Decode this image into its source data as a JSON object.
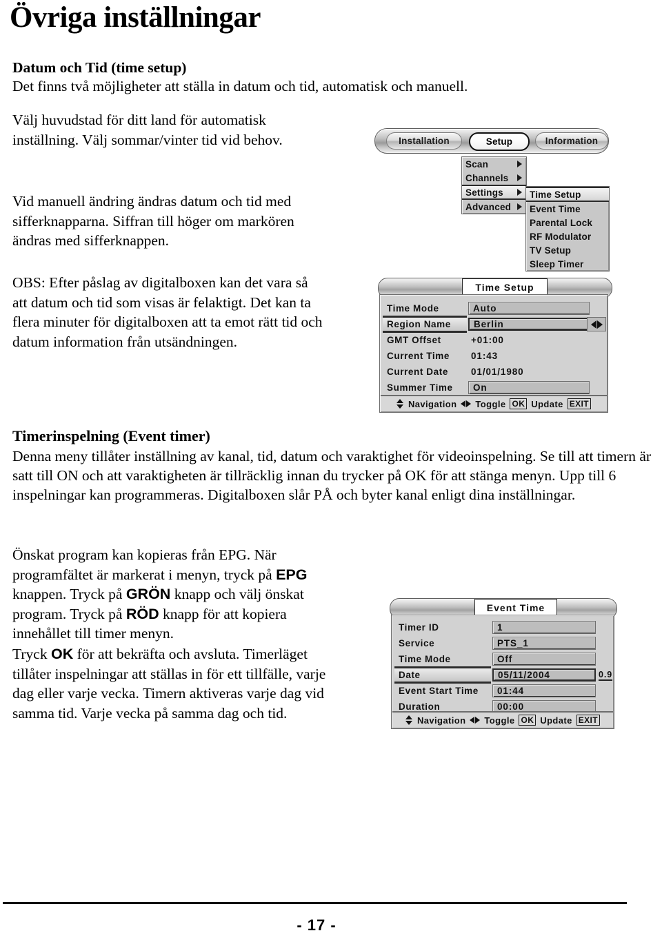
{
  "document": {
    "title": "Övriga inställningar",
    "page_number": "- 17 -"
  },
  "sections": {
    "time_setup": {
      "subheading": "Datum och Tid (time setup)",
      "lead": "Det finns två möjligheter att ställa in datum och tid, automatisk och manuell.",
      "para_auto": "Välj huvudstad för ditt land för automatisk inställning. Välj sommar/vinter tid vid behov.",
      "para_manual": "Vid manuell ändring ändras datum och tid med sifferknapparna. Siffran till höger om markören ändras med sifferknappen.",
      "para_obs": "OBS: Efter påslag av digitalboxen kan det vara så att datum och tid som visas är felaktigt. Det kan ta flera minuter för digitalboxen att ta emot rätt tid och datum information från utsändningen."
    },
    "event_timer": {
      "heading": "Timerinspelning (Event timer)",
      "body": "Denna meny tillåter inställning av kanal, tid, datum och varaktighet för videoinspelning. Se till att timern är satt till ON och att varaktigheten är tillräcklig innan du trycker på OK för att stänga menyn. Upp till 6 inspelningar kan programmeras. Digitalboxen slår PÅ och byter kanal enligt dina inställningar.",
      "epg_para": {
        "p1": "Önskat program kan kopieras från EPG. När programfältet är markerat i menyn, tryck på ",
        "b1": "EPG",
        "p2": " knappen. Tryck på ",
        "b2": "GRÖN",
        "p3": " knapp och välj önskat program. Tryck på ",
        "b3": "RÖD",
        "p4": " knapp för att kopiera innehållet till timer menyn."
      },
      "ok_para": {
        "p1": "Tryck ",
        "b1": "OK",
        "p2": " för att bekräfta och avsluta. Timerläget tillåter inspelningar att ställas in för ett tillfälle, varje dag eller varje vecka. Timern aktiveras varje dag vid samma tid. Varje vecka på samma dag och tid."
      }
    }
  },
  "figures": {
    "menu": {
      "tabs": [
        {
          "label": "Installation",
          "selected": false
        },
        {
          "label": "Setup",
          "selected": true
        },
        {
          "label": "Information",
          "selected": false
        }
      ],
      "main_menu": [
        {
          "label": "Scan",
          "has_submenu": true,
          "selected": false
        },
        {
          "label": "Channels",
          "has_submenu": true,
          "selected": false
        },
        {
          "label": "Settings",
          "has_submenu": true,
          "selected": true
        },
        {
          "label": "Advanced",
          "has_submenu": true,
          "selected": false
        }
      ],
      "sub_menu": [
        {
          "label": "Time Setup",
          "selected": true
        },
        {
          "label": "Event Time",
          "selected": false
        },
        {
          "label": "Parental Lock",
          "selected": false
        },
        {
          "label": "RF Modulator",
          "selected": false
        },
        {
          "label": "TV Setup",
          "selected": false
        },
        {
          "label": "Sleep Timer",
          "selected": false
        }
      ]
    },
    "time_setup_dialog": {
      "title": "Time Setup",
      "rows": [
        {
          "label": "Time Mode",
          "value": "Auto",
          "boxed": true,
          "highlighted": false
        },
        {
          "label": "Region Name",
          "value": "Berlin",
          "boxed": true,
          "highlighted": true
        },
        {
          "label": "GMT Offset",
          "value": "+01:00",
          "boxed": false,
          "highlighted": false
        },
        {
          "label": "Current Time",
          "value": "01:43",
          "boxed": false,
          "highlighted": false
        },
        {
          "label": "Current Date",
          "value": "01/01/1980",
          "boxed": false,
          "highlighted": false
        },
        {
          "label": "Summer Time",
          "value": "On",
          "boxed": true,
          "highlighted": false
        }
      ],
      "footer": {
        "navigation": "Navigation",
        "toggle": "Toggle",
        "ok_key": "OK",
        "update": "Update",
        "exit_key": "EXIT"
      }
    },
    "event_time_dialog": {
      "title": "Event Time",
      "rows": [
        {
          "label": "Timer ID",
          "value": "1",
          "boxed": true,
          "highlighted": false,
          "extra": ""
        },
        {
          "label": "Service",
          "value": "PTS_1",
          "boxed": true,
          "highlighted": false,
          "extra": ""
        },
        {
          "label": "Time Mode",
          "value": "Off",
          "boxed": true,
          "highlighted": false,
          "extra": ""
        },
        {
          "label": "Date",
          "value": "05/11/2004",
          "boxed": true,
          "highlighted": true,
          "extra": "0.9"
        },
        {
          "label": "Event Start Time",
          "value": "01:44",
          "boxed": true,
          "highlighted": false,
          "extra": ""
        },
        {
          "label": "Duration",
          "value": "00:00",
          "boxed": true,
          "highlighted": false,
          "extra": ""
        }
      ],
      "footer": {
        "navigation": "Navigation",
        "toggle": "Toggle",
        "ok_key": "OK",
        "update": "Update",
        "exit_key": "EXIT"
      }
    }
  }
}
